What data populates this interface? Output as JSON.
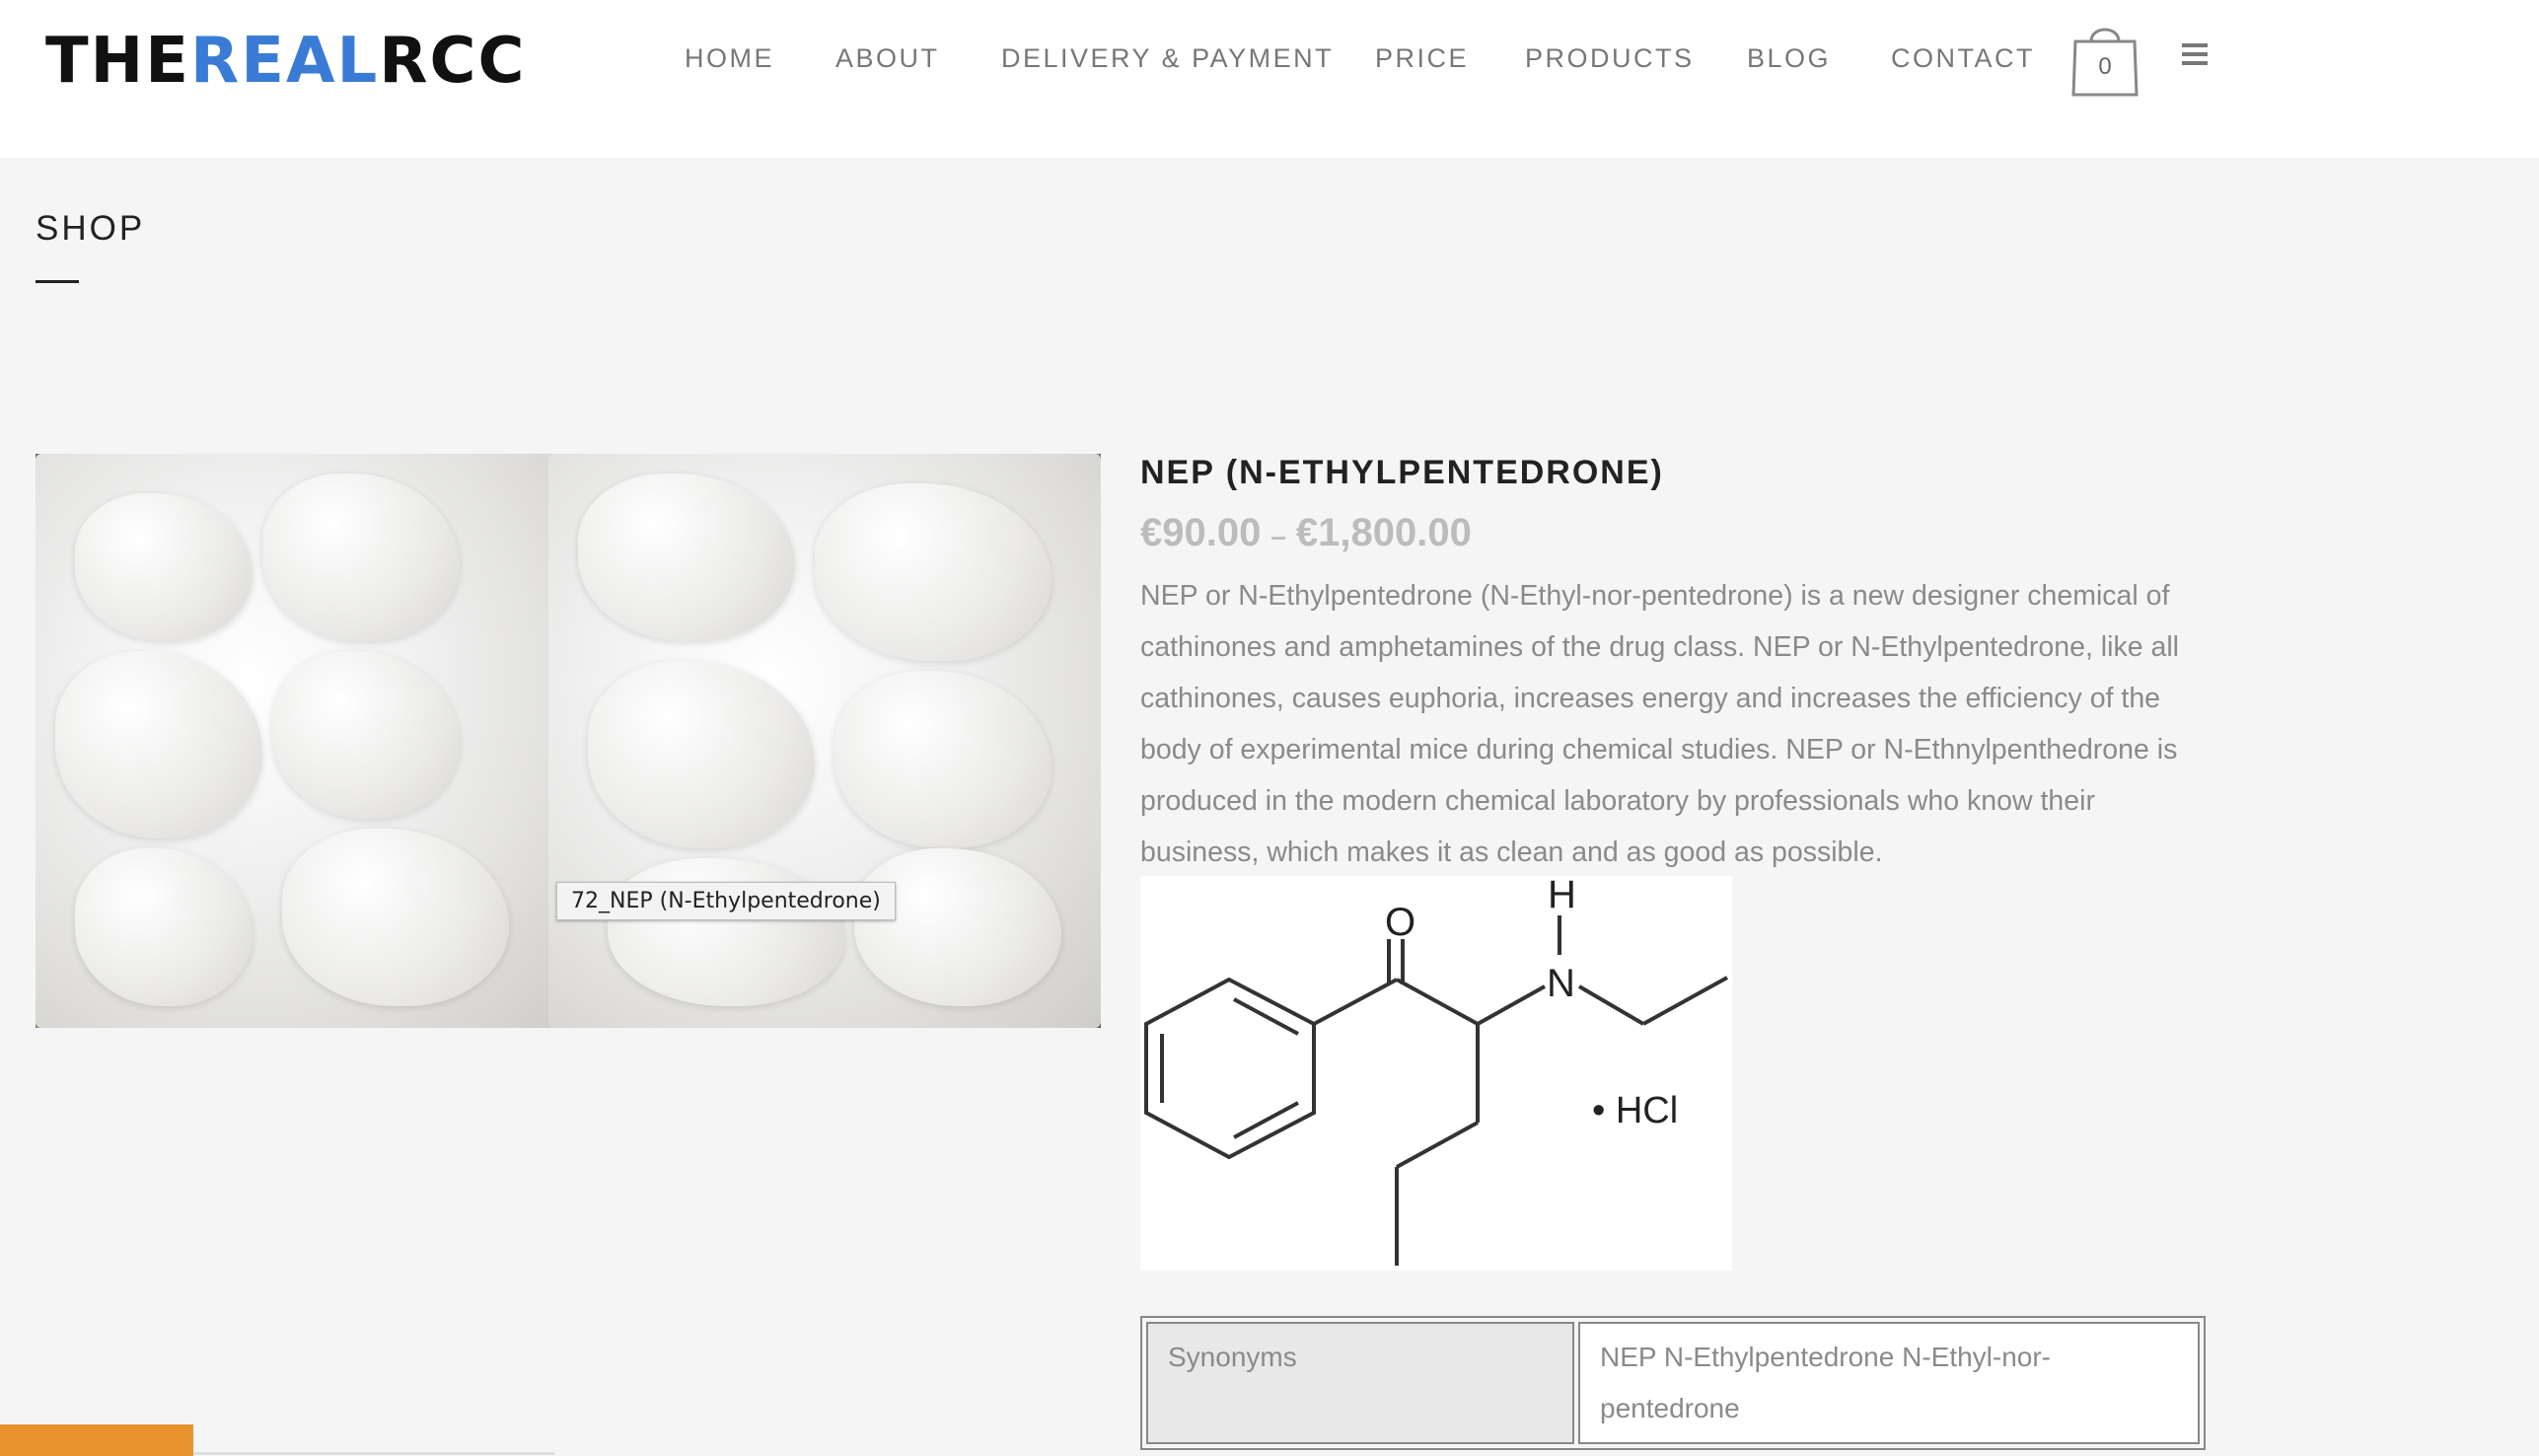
{
  "header": {
    "logo": {
      "part1": "THE",
      "part2": "REAL",
      "part3": "RCC"
    },
    "nav": [
      "HOME",
      "ABOUT",
      "DELIVERY & PAYMENT",
      "PRICE",
      "PRODUCTS",
      "BLOG",
      "CONTACT"
    ],
    "cart_count": "0",
    "menu_icon": "hamburger-icon",
    "cart_icon": "shopping-bag-icon"
  },
  "page": {
    "title": "SHOP"
  },
  "product": {
    "image_tooltip": "72_NEP (N-Ethylpentedrone)",
    "title": "NEP (N-ETHYLPENTEDRONE)",
    "price_min": "€90.00",
    "price_sep": "–",
    "price_max": "€1,800.00",
    "description": "NEP or N-Ethylpentedrone (N-Ethyl-nor-pentedrone) is a new designer chemical of cathinones and amphetamines of the drug class. NEP or N-Ethylpentedrone, like all cathinones, causes euphoria, increases energy and increases the efficiency of the body of experimental mice during chemical studies. NEP or N-Ethnylpenthedrone is produced in the modern chemical laboratory by professionals who know their business, which makes it as clean and as good as possible.",
    "structure": {
      "atom_o": "O",
      "atom_h": "H",
      "atom_n": "N",
      "salt": "• HCl"
    },
    "specs": [
      {
        "key": "Synonyms",
        "value": "NEP N-Ethylpentedrone N-Ethyl-nor-pentedrone"
      }
    ]
  },
  "colors": {
    "accent": "#3a7bd5",
    "footer_bar": "#e8922e"
  }
}
